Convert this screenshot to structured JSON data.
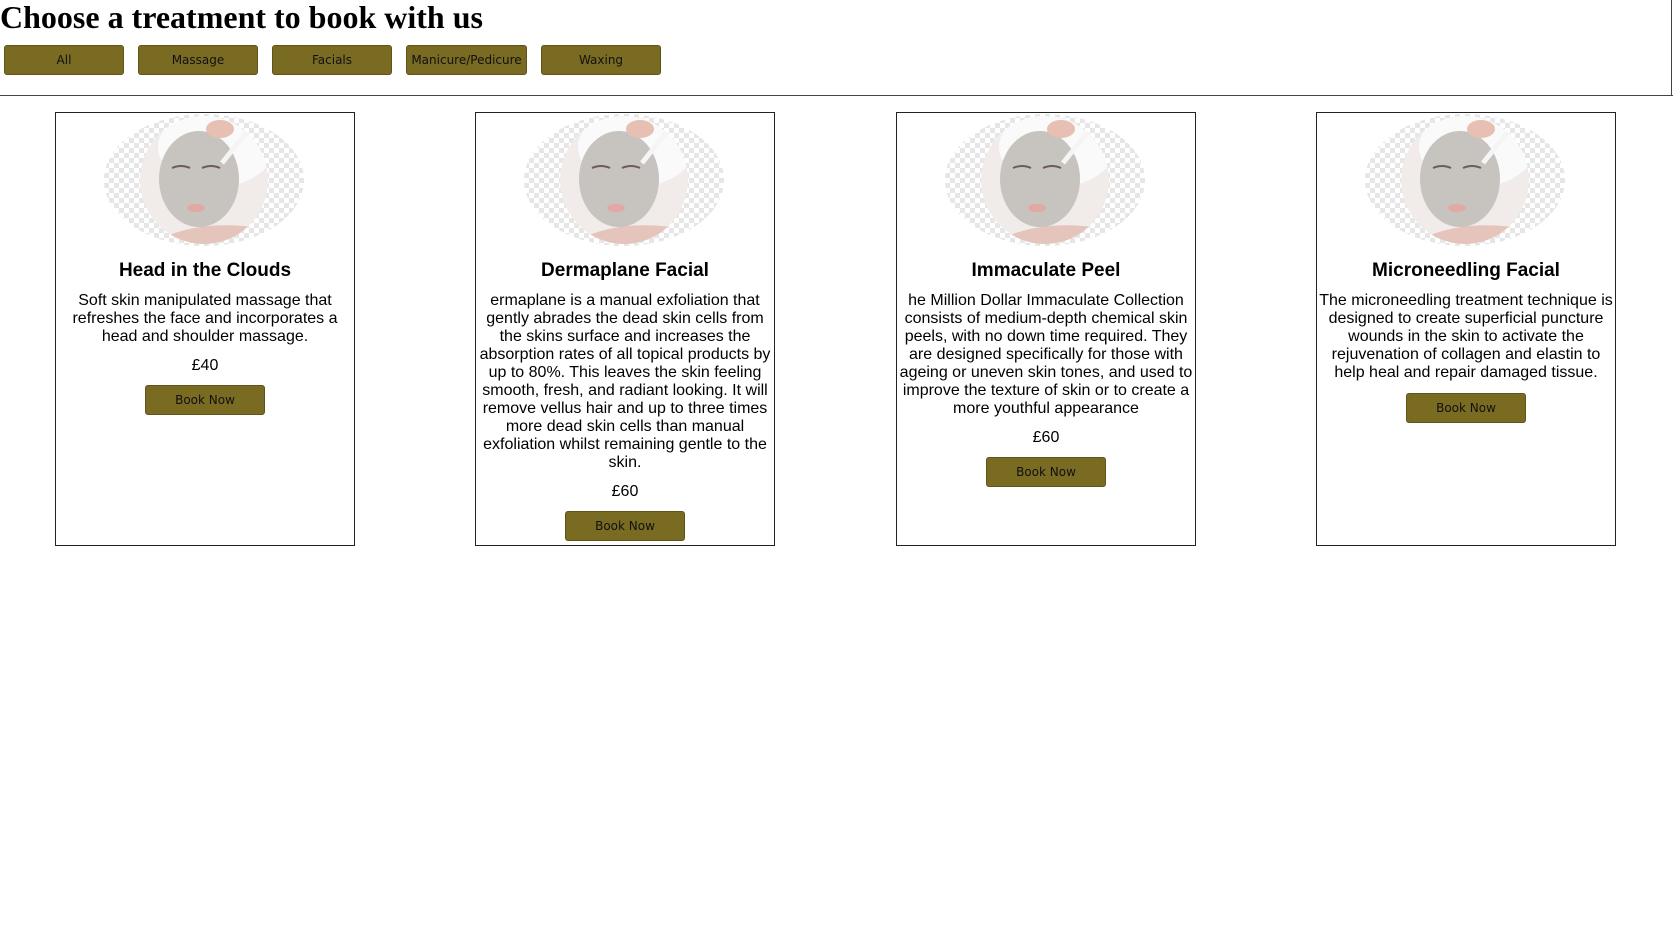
{
  "page": {
    "title": "Choose a treatment to book with us"
  },
  "filters": [
    {
      "label": "All"
    },
    {
      "label": "Massage"
    },
    {
      "label": "Facials"
    },
    {
      "label": "Manicure/Pedicure"
    },
    {
      "label": "Waxing"
    }
  ],
  "theme": {
    "button_color": "#7a6b22",
    "border_color": "#222222"
  },
  "treatments": [
    {
      "name": "Head in the Clouds",
      "description": "Soft skin manipulated massage that refreshes the face and incorporates a head and shoulder massage.",
      "price": "£40",
      "button_label": "Book Now"
    },
    {
      "name": "Dermaplane Facial",
      "description": "ermaplane is a manual exfoliation that gently abrades the dead skin cells from the skins surface and increases the absorption rates of all topical products by up to 80%. This leaves the skin feeling smooth, fresh, and radiant looking. It will remove vellus hair and up to three times more dead skin cells than manual exfoliation whilst remaining gentle to the skin.",
      "price": "£60",
      "button_label": "Book Now"
    },
    {
      "name": "Immaculate Peel",
      "description": "he Million Dollar Immaculate Collection consists of medium-depth chemical skin peels, with no down time required. They are designed specifically for those with ageing or uneven skin tones, and used to improve the texture of skin or to create a more youthful appearance",
      "price": "£60",
      "button_label": "Book Now"
    },
    {
      "name": "Microneedling Facial",
      "description": "The microneedling treatment technique is designed to create superficial puncture wounds in the skin to activate the rejuvenation of collagen and elastin to help heal and repair damaged tissue.",
      "price": "",
      "button_label": "Book Now"
    }
  ]
}
